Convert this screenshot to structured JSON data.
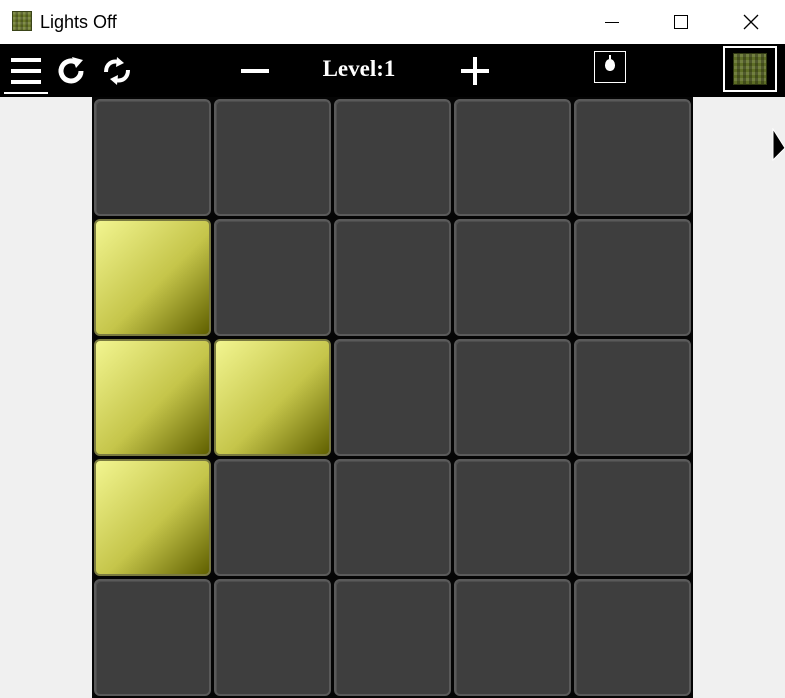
{
  "window": {
    "title": "Lights Off",
    "app_icon": "checker-grid-icon",
    "controls": [
      "minimize-icon",
      "maximize-icon",
      "close-icon"
    ]
  },
  "toolbar": {
    "menu_icon": "hamburger-menu-icon",
    "restart_icon": "refresh-icon",
    "swap_icon": "swap-arrows-icon",
    "prev_level_icon": "minus-icon",
    "level_label": "Level:1",
    "next_level_icon": "plus-icon",
    "hint_icon": "lightbulb-icon",
    "theme_icon": "theme-swatch-icon"
  },
  "board": {
    "rows": 5,
    "cols": 5,
    "cells": [
      [
        0,
        0,
        0,
        0,
        0
      ],
      [
        1,
        0,
        0,
        0,
        0
      ],
      [
        1,
        1,
        0,
        0,
        0
      ],
      [
        1,
        0,
        0,
        0,
        0
      ],
      [
        0,
        0,
        0,
        0,
        0
      ]
    ]
  },
  "colors": {
    "toolbar_bg": "#000000",
    "cell_off": "#3e3e3e",
    "cell_on_light": "#f2f590",
    "cell_on_dark": "#606000",
    "board_bg": "#050505",
    "page_bg": "#f0f0f0"
  }
}
